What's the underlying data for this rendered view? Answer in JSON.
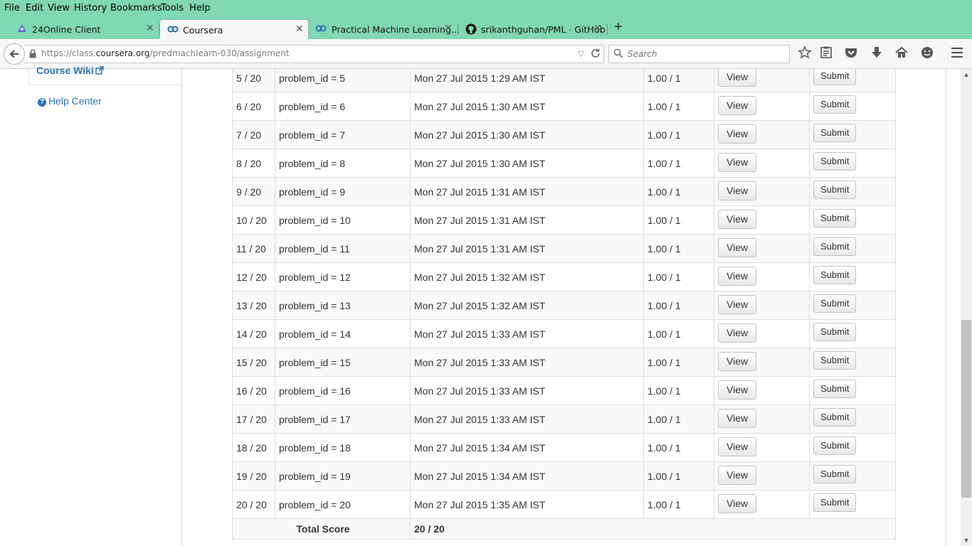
{
  "menu": [
    "File",
    "Edit",
    "View",
    "History",
    "Bookmarks",
    "Tools",
    "Help"
  ],
  "tabs": [
    {
      "title": "24Online Client",
      "icon": "portal-icon"
    },
    {
      "title": "Coursera",
      "icon": "coursera-icon"
    },
    {
      "title": "Practical Machine Learning...",
      "icon": "coursera-icon"
    },
    {
      "title": "srikanthguhan/PML · GitHub",
      "icon": "github-icon"
    }
  ],
  "url": {
    "prefix": "https://class.",
    "domain": "coursera.org",
    "path": "/predmachlearn-030/assignment"
  },
  "search": {
    "placeholder": "Search"
  },
  "sidebar": {
    "course_wiki": "Course Wiki",
    "help_center": "Help Center"
  },
  "table": {
    "view_label": "View",
    "submit_label": "Submit",
    "rows": [
      {
        "num": "5 / 20",
        "problem": "problem_id = 5",
        "time": "Mon 27 Jul 2015 1:29 AM IST",
        "score": "1.00 / 1"
      },
      {
        "num": "6 / 20",
        "problem": "problem_id = 6",
        "time": "Mon 27 Jul 2015 1:30 AM IST",
        "score": "1.00 / 1"
      },
      {
        "num": "7 / 20",
        "problem": "problem_id = 7",
        "time": "Mon 27 Jul 2015 1:30 AM IST",
        "score": "1.00 / 1"
      },
      {
        "num": "8 / 20",
        "problem": "problem_id = 8",
        "time": "Mon 27 Jul 2015 1:30 AM IST",
        "score": "1.00 / 1"
      },
      {
        "num": "9 / 20",
        "problem": "problem_id = 9",
        "time": "Mon 27 Jul 2015 1:31 AM IST",
        "score": "1.00 / 1"
      },
      {
        "num": "10 / 20",
        "problem": "problem_id = 10",
        "time": "Mon 27 Jul 2015 1:31 AM IST",
        "score": "1.00 / 1"
      },
      {
        "num": "11 / 20",
        "problem": "problem_id = 11",
        "time": "Mon 27 Jul 2015 1:31 AM IST",
        "score": "1.00 / 1"
      },
      {
        "num": "12 / 20",
        "problem": "problem_id = 12",
        "time": "Mon 27 Jul 2015 1:32 AM IST",
        "score": "1.00 / 1"
      },
      {
        "num": "13 / 20",
        "problem": "problem_id = 13",
        "time": "Mon 27 Jul 2015 1:32 AM IST",
        "score": "1.00 / 1"
      },
      {
        "num": "14 / 20",
        "problem": "problem_id = 14",
        "time": "Mon 27 Jul 2015 1:33 AM IST",
        "score": "1.00 / 1"
      },
      {
        "num": "15 / 20",
        "problem": "problem_id = 15",
        "time": "Mon 27 Jul 2015 1:33 AM IST",
        "score": "1.00 / 1"
      },
      {
        "num": "16 / 20",
        "problem": "problem_id = 16",
        "time": "Mon 27 Jul 2015 1:33 AM IST",
        "score": "1.00 / 1"
      },
      {
        "num": "17 / 20",
        "problem": "problem_id = 17",
        "time": "Mon 27 Jul 2015 1:33 AM IST",
        "score": "1.00 / 1"
      },
      {
        "num": "18 / 20",
        "problem": "problem_id = 18",
        "time": "Mon 27 Jul 2015 1:34 AM IST",
        "score": "1.00 / 1"
      },
      {
        "num": "19 / 20",
        "problem": "problem_id = 19",
        "time": "Mon 27 Jul 2015 1:34 AM IST",
        "score": "1.00 / 1"
      },
      {
        "num": "20 / 20",
        "problem": "problem_id = 20",
        "time": "Mon 27 Jul 2015 1:35 AM IST",
        "score": "1.00 / 1"
      }
    ],
    "total_label": "Total Score",
    "total_value": "20 / 20"
  },
  "colors": {
    "chrome": "#80d7b5",
    "link": "#2a73b8"
  }
}
